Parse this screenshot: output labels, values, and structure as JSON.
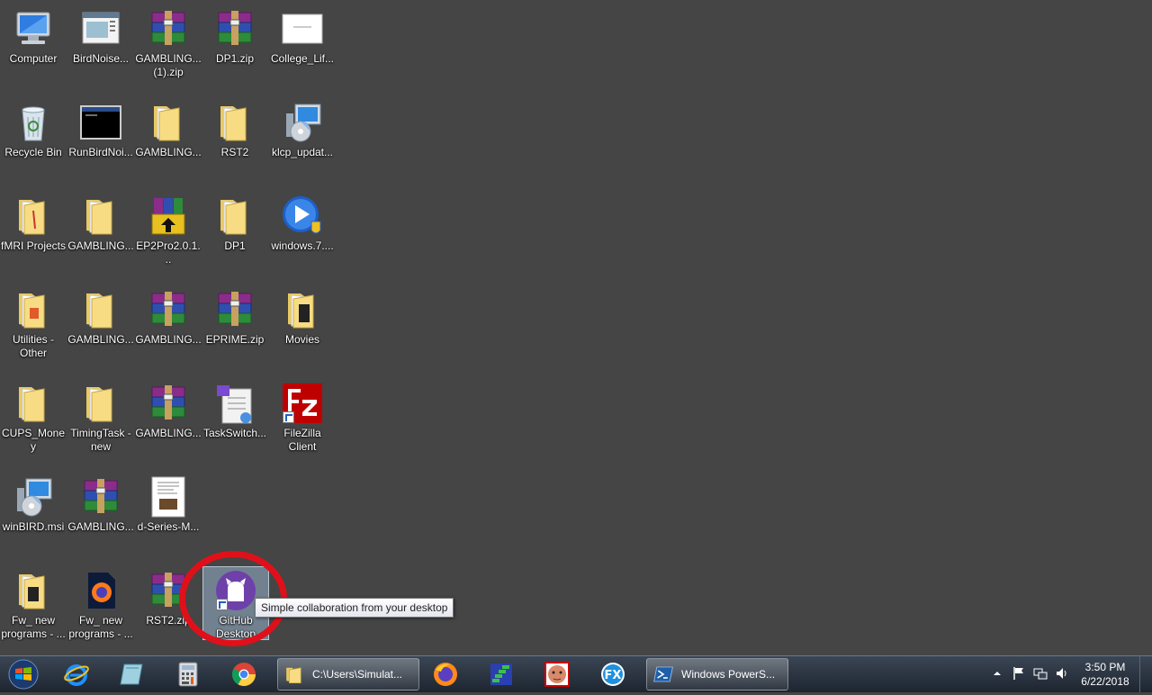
{
  "desktop_icons": [
    {
      "label": "Computer",
      "type": "computer"
    },
    {
      "label": "BirdNoise...",
      "type": "window-app"
    },
    {
      "label": "GAMBLING... (1).zip",
      "type": "zip"
    },
    {
      "label": "DP1.zip",
      "type": "zip"
    },
    {
      "label": "College_Lif...",
      "type": "document"
    },
    {
      "label": "Recycle Bin",
      "type": "recycle-bin"
    },
    {
      "label": "RunBirdNoi...",
      "type": "console"
    },
    {
      "label": "GAMBLING...",
      "type": "folder"
    },
    {
      "label": "RST2",
      "type": "folder"
    },
    {
      "label": "klcp_updat...",
      "type": "installer"
    },
    {
      "label": "fMRI Projects",
      "type": "folder"
    },
    {
      "label": "GAMBLING...",
      "type": "folder"
    },
    {
      "label": "EP2Pro2.0.1...",
      "type": "winrar-sfx"
    },
    {
      "label": "DP1",
      "type": "folder"
    },
    {
      "label": "windows.7....",
      "type": "media"
    },
    {
      "label": "Utilities - Other",
      "type": "folder"
    },
    {
      "label": "GAMBLING...",
      "type": "folder"
    },
    {
      "label": "GAMBLING...",
      "type": "zip"
    },
    {
      "label": "EPRIME.zip",
      "type": "zip"
    },
    {
      "label": "Movies",
      "type": "folder"
    },
    {
      "label": "CUPS_Money",
      "type": "folder"
    },
    {
      "label": "TimingTask - new",
      "type": "folder"
    },
    {
      "label": "GAMBLING...",
      "type": "zip"
    },
    {
      "label": "TaskSwitch...",
      "type": "document-app"
    },
    {
      "label": "FileZilla Client",
      "type": "filezilla"
    },
    {
      "label": "winBIRD.msi",
      "type": "installer"
    },
    {
      "label": "GAMBLING...",
      "type": "zip"
    },
    {
      "label": "d-Series-M...",
      "type": "document"
    },
    {
      "label": "Fw_ new programs - ...",
      "type": "folder"
    },
    {
      "label": "Fw_ new programs - ...",
      "type": "firefox-file"
    },
    {
      "label": "RST2.zip",
      "type": "zip"
    },
    {
      "label": "GitHub Desktop",
      "type": "github"
    }
  ],
  "tooltip": {
    "text": "Simple collaboration from your desktop"
  },
  "taskbar": {
    "explorer_window_label": "C:\\Users\\Simulat...",
    "powershell_window_label": "Windows PowerS..."
  },
  "clock": {
    "time": "3:50 PM",
    "date": "6/22/2018"
  },
  "colors": {
    "desktop": "#454545",
    "highlight_ring": "#e0101a"
  }
}
